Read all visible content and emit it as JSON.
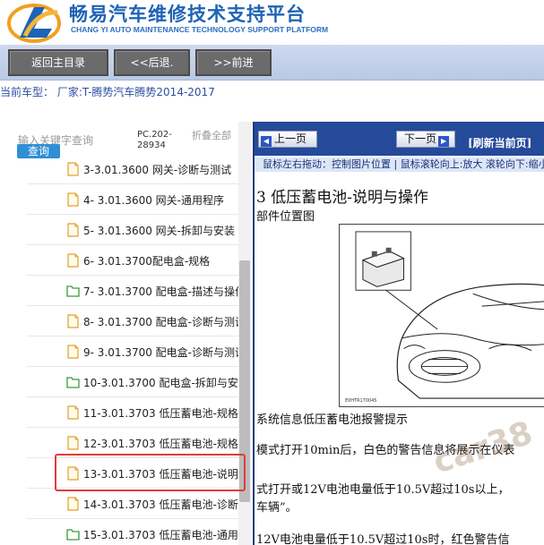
{
  "header": {
    "title_cn": "畅易汽车维修技术支持平台",
    "title_en": "CHANG YI AUTO MAINTENANCE TECHNOLOGY SUPPORT PLATFORM"
  },
  "toolbar": {
    "main_menu": "返回主目录",
    "back": "<<后退.",
    "forward": ">>前进"
  },
  "vehicle": {
    "line": "当前车型：  厂家:T-腾势汽车腾势2014-2017"
  },
  "search": {
    "placeholder": "输入关键字查询",
    "button": "查询",
    "pc_code": "PC.202-28934",
    "collapse_all": "折叠全部"
  },
  "tree": {
    "items": [
      {
        "label": "3-3.01.3600 网关-诊断与测试",
        "icon": "file-icon"
      },
      {
        "label": "4- 3.01.3600 网关-通用程序",
        "icon": "file-icon"
      },
      {
        "label": "5- 3.01.3600 网关-拆卸与安装",
        "icon": "file-icon"
      },
      {
        "label": "6- 3.01.3700配电盒-规格",
        "icon": "file-icon"
      },
      {
        "label": "7- 3.01.3700 配电盒-描述与操作",
        "icon": "folder-icon"
      },
      {
        "label": "8- 3.01.3700 配电盒-诊断与测试",
        "icon": "file-icon"
      },
      {
        "label": "9- 3.01.3700 配电盒-诊断与测试",
        "icon": "file-icon"
      },
      {
        "label": "10-3.01.3700 配电盒-拆卸与安装",
        "icon": "folder-icon"
      },
      {
        "label": "11-3.01.3703 低压蓄电池-规格",
        "icon": "file-icon"
      },
      {
        "label": "12-3.01.3703 低压蓄电池-规格",
        "icon": "file-icon"
      },
      {
        "label": "13-3.01.3703 低压蓄电池-说明与操作",
        "icon": "file-icon",
        "selected": true
      },
      {
        "label": "14-3.01.3703 低压蓄电池-诊断与测试",
        "icon": "file-icon"
      },
      {
        "label": "15-3.01.3703 低压蓄电池-通用程序",
        "icon": "folder-icon"
      }
    ]
  },
  "viewer": {
    "prev": "上一页",
    "next": "下一页",
    "refresh": "[刷新当前页]",
    "hint": "鼠标左右拖动：控制图片位置 | 鼠标滚轮向上:放大  滚轮向下:缩小",
    "doc_title": "3 低压蓄电池-说明与操作",
    "doc_sub": "部件位置图",
    "para1": "系统信息低压蓄电池报警提示",
    "para2": "模式打开10min后，白色的警告信息将展示在仪表",
    "para3": "式打开或12V电池电量低于10.5V超过10s以上，",
    "para4": "车辆”。",
    "para5": "12V电池电量低于10.5V超过10s时，红色警告信",
    "watermark": "car38"
  },
  "colors": {
    "brand_blue": "#1e63b5",
    "nav_blue": "#254a9a",
    "highlight_red": "#e23b3b"
  }
}
